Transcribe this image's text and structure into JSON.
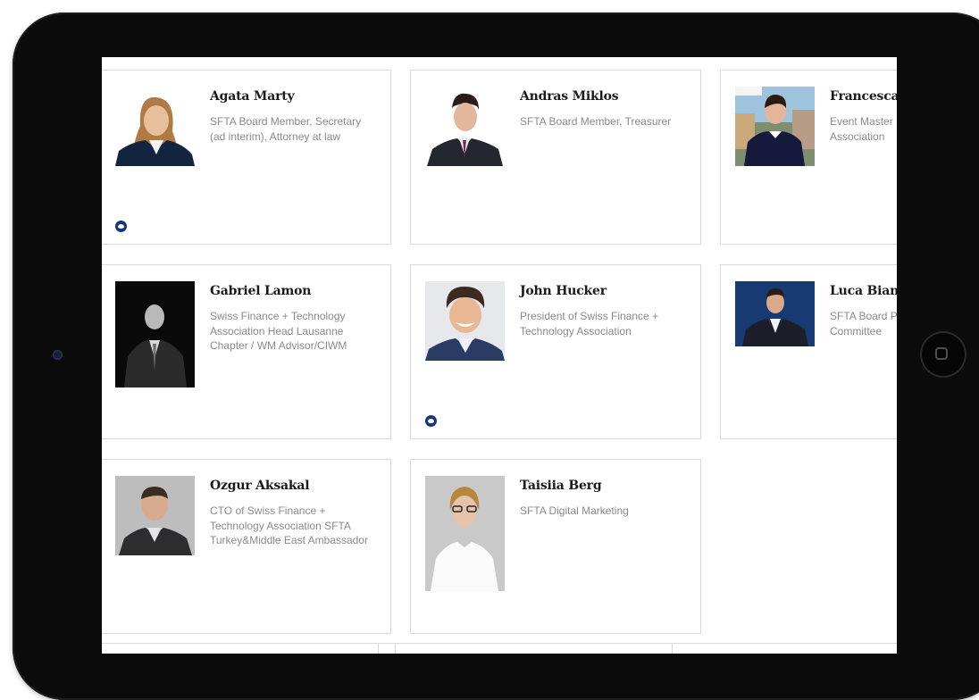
{
  "members": [
    {
      "name": "Agata Marty",
      "role": "SFTA Board Member, Secretary (ad interim), Attorney at law",
      "has_link_icon": true
    },
    {
      "name": "Andras Miklos",
      "role": "SFTA Board Member, Treasurer",
      "has_link_icon": false
    },
    {
      "name": "Francesca",
      "role": "Event Master Finance + Te Association",
      "has_link_icon": false
    },
    {
      "name": "Gabriel Lamon",
      "role": "Swiss Finance + Technology Association Head Lausanne Chapter / WM Advisor/CIWM",
      "has_link_icon": false
    },
    {
      "name": "John Hucker",
      "role": "President of Swiss Finance + Technology Association",
      "has_link_icon": true
    },
    {
      "name": "Luca Bian",
      "role": "SFTA Board President & Committee",
      "has_link_icon": false
    },
    {
      "name": "Ozgur Aksakal",
      "role": "CTO of Swiss Finance + Technology Association SFTA Turkey&Middle East Ambassador",
      "has_link_icon": false
    },
    {
      "name": "Taisiia Berg",
      "role": "SFTA Digital Marketing",
      "has_link_icon": false
    }
  ],
  "colors": {
    "device_bezel": "#0b0b0c",
    "card_border": "#d9d9d9",
    "name_text": "#1a1a1a",
    "role_text": "#8a8a8a",
    "link_icon": "#14377a"
  },
  "icons": {
    "member_link": "linkedin-icon"
  }
}
